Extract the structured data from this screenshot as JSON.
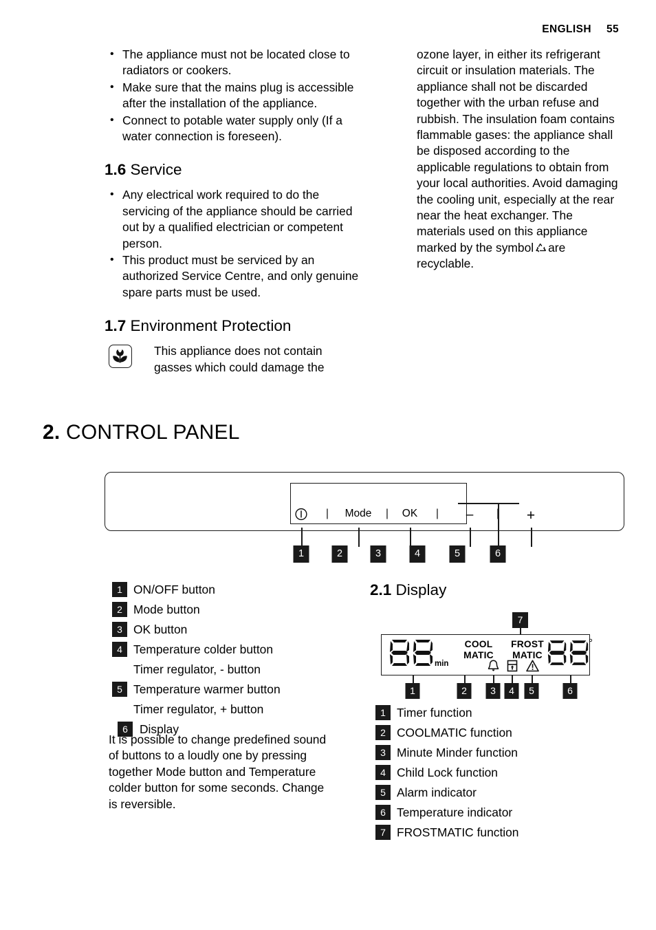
{
  "header": {
    "language": "ENGLISH",
    "page_number": "55"
  },
  "left_column": {
    "bullets_top": [
      "The appliance must not be located close to radiators or cookers.",
      "Make sure that the mains plug is accessible after the installation of the appliance.",
      "Connect to potable water supply only (If a water connection is foreseen)."
    ],
    "service": {
      "number": "1.6",
      "title": "Service",
      "bullets": [
        "Any electrical work required to do the servicing of the appliance should be carried out by a qualified electrician or competent person.",
        "This product must be serviced by an authorized Service Centre, and only genuine spare parts must be used."
      ]
    },
    "environment": {
      "number": "1.7",
      "title": "Environment Protection",
      "icon": "tulip-flower-icon",
      "text": "This appliance does not contain gasses which could damage the"
    }
  },
  "right_column": {
    "continuation_before_symbol": "ozone layer, in either its refrigerant circuit or insulation materials. The appliance shall not be discarded together with the urban refuse and rubbish. The insulation foam contains flammable gases: the appliance shall be disposed according to the applicable regulations to obtain from your local authorities. Avoid damaging the cooling unit, especially at the rear near the heat exchanger. The materials used on this appliance marked by the symbol",
    "symbol_icon": "recycling-icon",
    "continuation_after_symbol": "are recyclable."
  },
  "chapter": {
    "number": "2.",
    "title": "CONTROL PANEL"
  },
  "control_panel": {
    "buttons": [
      {
        "id": "1",
        "glyph": "power-icon",
        "label": ""
      },
      {
        "id": "2",
        "glyph": "text",
        "label": "Mode"
      },
      {
        "id": "3",
        "glyph": "text",
        "label": "OK"
      },
      {
        "id": "4",
        "glyph": "minus-icon",
        "label": "–"
      },
      {
        "id": "5",
        "glyph": "plus-icon",
        "label": "+"
      },
      {
        "id": "6",
        "glyph": "display-area",
        "label": ""
      }
    ],
    "separators": [
      "|",
      "|",
      "|",
      "|"
    ],
    "callouts": [
      "1",
      "2",
      "3",
      "4",
      "5",
      "6"
    ]
  },
  "control_panel_legend": [
    {
      "num": "1",
      "text": "ON/OFF button"
    },
    {
      "num": "2",
      "text": "Mode button"
    },
    {
      "num": "3",
      "text": "OK button"
    },
    {
      "num": "4",
      "text": "Temperature colder button"
    },
    {
      "num": "",
      "text": "Timer regulator, - button"
    },
    {
      "num": "5",
      "text": "Temperature warmer button"
    },
    {
      "num": "",
      "text": "Timer regulator, + button"
    },
    {
      "num": "6",
      "text": "Display"
    }
  ],
  "note_paragraph": "It is possible to change predefined sound of buttons to a loudly one by pressing together Mode button and Temperature colder button for some seconds. Change is reversible.",
  "display_section": {
    "number": "2.1",
    "title": "Display",
    "diagram": {
      "timer_digits": "88",
      "timer_unit": "min",
      "coolmatic_line1": "COOL",
      "coolmatic_line2": "MATIC",
      "frostmatic_line1": "FROST",
      "frostmatic_line2": "MATIC",
      "bell_icon": "bell-icon",
      "child_lock_icon": "child-lock-icon",
      "alarm_icon": "warning-triangle-icon",
      "temperature_digits": "88",
      "degree_symbol": "°",
      "callouts": [
        "1",
        "2",
        "3",
        "4",
        "5",
        "6",
        "7"
      ]
    },
    "legend": [
      {
        "num": "1",
        "text": "Timer function"
      },
      {
        "num": "2",
        "text": "COOLMATIC function"
      },
      {
        "num": "3",
        "text": "Minute Minder function"
      },
      {
        "num": "4",
        "text": "Child Lock function"
      },
      {
        "num": "5",
        "text": "Alarm indicator"
      },
      {
        "num": "6",
        "text": "Temperature indicator"
      },
      {
        "num": "7",
        "text": "FROSTMATIC function"
      }
    ]
  }
}
